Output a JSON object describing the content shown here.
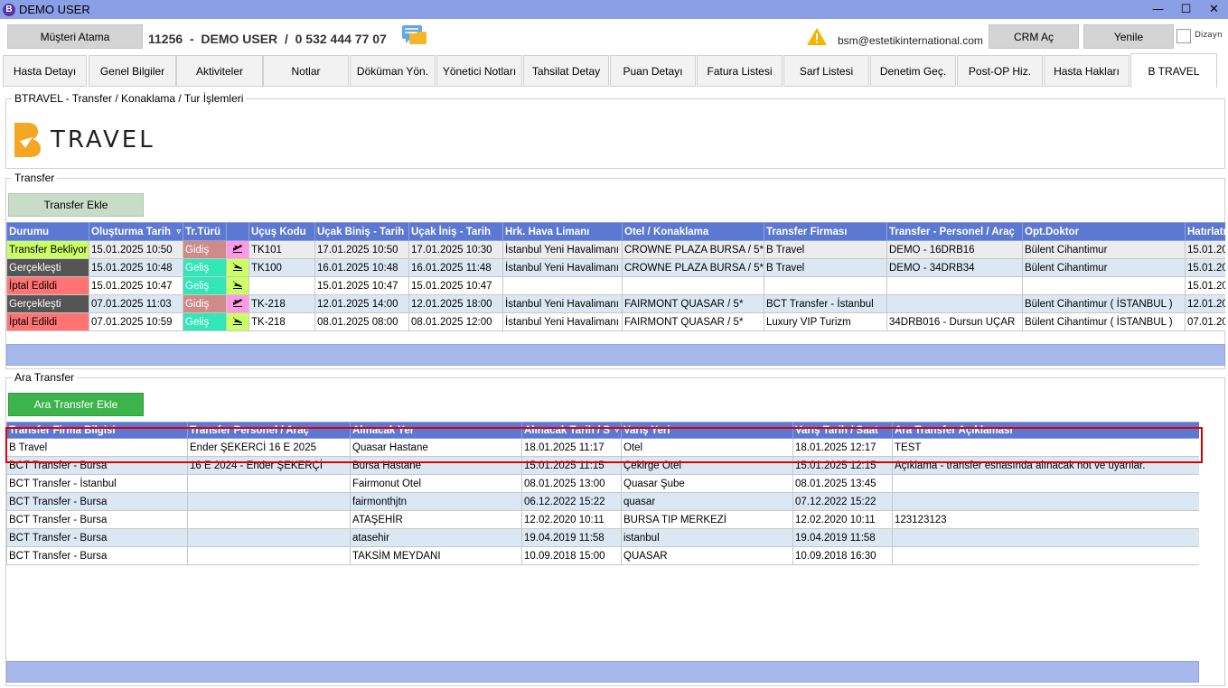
{
  "window": {
    "title": "DEMO USER",
    "app_icon": "B"
  },
  "header": {
    "assign_button": "Müşteri Atama",
    "patient_line": "11256  -  DEMO USER  /  0 532 444 77 07",
    "email": "bsm@estetikinternational.com",
    "crm_button": "CRM Aç",
    "refresh_button": "Yenile",
    "dizayn_label": "Dizayn"
  },
  "tabs": [
    "Hasta Detayı",
    "Genel Bilgiler",
    "Aktiviteler",
    "Notlar",
    "Döküman Yön.",
    "Yönetici Notları",
    "Tahsilat Detay",
    "Puan Detayı",
    "Fatura Listesi",
    "Sarf Listesi",
    "Denetim Geç.",
    "Post-OP Hiz.",
    "Hasta Hakları",
    "B TRAVEL"
  ],
  "btravel": {
    "group_title": "BTRAVEL - Transfer / Konaklama / Tur İşlemleri",
    "logo_text": "TRAVEL"
  },
  "transfer": {
    "group_title": "Transfer",
    "add_button": "Transfer Ekle",
    "columns": [
      "Durumu",
      "Oluşturma Tarih",
      "Tr.Türü",
      "",
      "Uçuş Kodu",
      "Uçak Biniş - Tarih",
      "Uçak İniş - Tarih",
      "Hrk. Hava Limanı",
      "Otel / Konaklama",
      "Transfer Firması",
      "Transfer - Personel / Araç",
      "Opt.Doktor",
      "Hatırlatm"
    ],
    "rows": [
      [
        "Transfer Bekliyor",
        "15.01.2025 10:50",
        "Gidiş",
        "",
        "TK101",
        "17.01.2025 10:50",
        "17.01.2025 10:30",
        "İstanbul Yeni Havalimanı",
        "CROWNE PLAZA BURSA / 5*",
        "B Travel",
        "DEMO - 16DRB16",
        "Bülent Cihantimur",
        "15.01.20"
      ],
      [
        "Gerçekleşti",
        "15.01.2025 10:48",
        "Geliş",
        "",
        "TK100",
        "16.01.2025 10:48",
        "16.01.2025 11:48",
        "İstanbul Yeni Havalimanı",
        "CROWNE PLAZA BURSA / 5*",
        "B Travel",
        "DEMO - 34DRB34",
        "Bülent Cihantimur",
        "15.01.20"
      ],
      [
        "İptal Edildi",
        "15.01.2025 10:47",
        "Geliş",
        "",
        "",
        "15.01.2025 10:47",
        "15.01.2025 10:47",
        "",
        "",
        "",
        "",
        "",
        "15.01.20"
      ],
      [
        "Gerçekleşti",
        "07.01.2025 11:03",
        "Gidiş",
        "",
        "TK-218",
        "12.01.2025 14:00",
        "12.01.2025 18:00",
        "İstanbul Yeni Havalimanı",
        "FAIRMONT QUASAR / 5*",
        "BCT Transfer - İstanbul",
        "",
        "Bülent Cihantimur ( İSTANBUL )",
        "12.01.20"
      ],
      [
        "İptal Edildi",
        "07.01.2025 10:59",
        "Geliş",
        "",
        "TK-218",
        "08.01.2025 08:00",
        "08.01.2025 12:00",
        "İstanbul Yeni Havalimanı",
        "FAIRMONT QUASAR / 5*",
        "Luxury VIP Turizm",
        "34DRB016 - Dursun UÇAR",
        "Bülent Cihantimur ( İSTANBUL )",
        "07.01.20"
      ]
    ]
  },
  "ara_transfer": {
    "group_title": "Ara Transfer",
    "add_button": "Ara Transfer Ekle",
    "columns": [
      "Transfer Firma Bilgisi",
      "Transfer Personel / Araç",
      "Alınacak Yer",
      "Alınacak Tarih / S",
      "Varış Yeri",
      "Varış Tarih / Saat",
      "Ara Transfer Açıklaması"
    ],
    "rows": [
      [
        "B Travel",
        "Ender ŞEKERCİ 16 E 2025",
        "Quasar Hastane",
        "18.01.2025 11:17",
        "Otel",
        "18.01.2025 12:17",
        "TEST"
      ],
      [
        "BCT Transfer - Bursa",
        "16 E 2024 - Ender ŞEKERÇİ",
        "Bursa Hastane",
        "15.01.2025 11:15",
        "Çekirge Otel",
        "15.01.2025 12:15",
        "Açıklama - transfer esnasında alınacak not ve uyarılar."
      ],
      [
        "BCT Transfer - İstanbul",
        "",
        "Fairmonut Otel",
        "08.01.2025 13:00",
        "Quasar Şube",
        "08.01.2025 13:45",
        ""
      ],
      [
        "BCT Transfer - Bursa",
        "",
        "fairmonthjtn",
        "06.12.2022 15:22",
        "quasar",
        "07.12.2022 15:22",
        ""
      ],
      [
        "BCT Transfer - Bursa",
        "",
        "ATAŞEHİR",
        "12.02.2020 10:11",
        "BURSA TIP MERKEZİ",
        "12.02.2020 10:11",
        "123123123"
      ],
      [
        "BCT Transfer - Bursa",
        "",
        "atasehir",
        "19.04.2019 11:58",
        "istanbul",
        "19.04.2019 11:58",
        ""
      ],
      [
        "BCT Transfer - Bursa",
        "",
        "TAKSİM MEYDANI",
        "10.09.2018 15:00",
        "QUASAR",
        "10.09.2018 16:30",
        ""
      ]
    ]
  },
  "colors": {
    "title_bar": "#8a9fe6",
    "grid_header": "#5b79d3",
    "status_waiting": "#ccff66",
    "status_done": "#555555",
    "status_cancel": "#ff7373",
    "type_gidis": "#d08a88",
    "type_gelis": "#33e6b8",
    "icon_gidis": "#ff99e6",
    "icon_gelis": "#ccff66",
    "row_alt": "#dbe8f4",
    "highlight": "#e00000"
  }
}
